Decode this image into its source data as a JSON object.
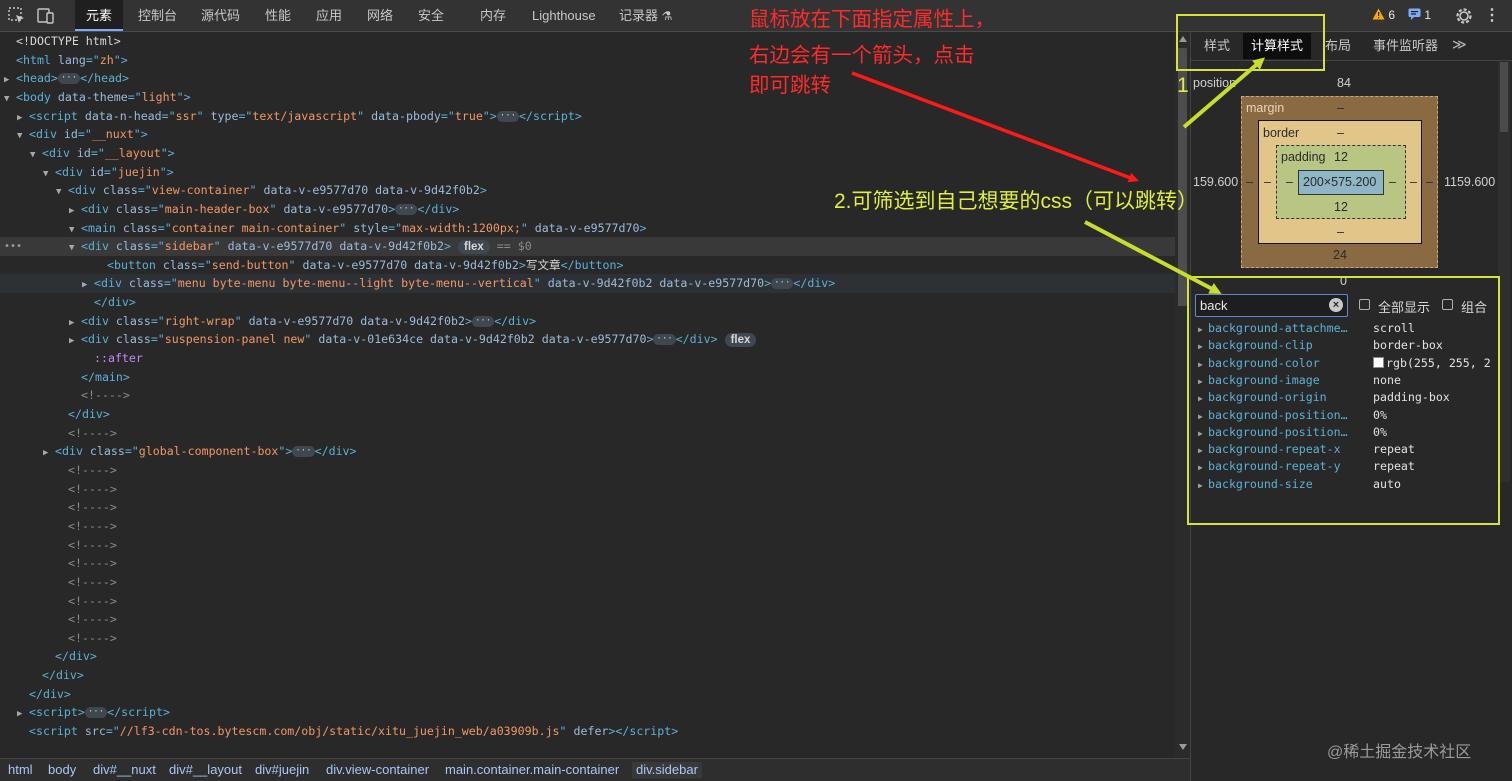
{
  "toolbar": {
    "tabs": [
      "元素",
      "控制台",
      "源代码",
      "性能",
      "应用",
      "网络",
      "安全",
      "内存",
      "Lighthouse",
      "记录器"
    ],
    "warnings_count": "6",
    "messages_count": "1"
  },
  "tree_lines": [
    {
      "text": "<!DOCTYPE html>"
    },
    {
      "tw": "",
      "tag": "html",
      "attrs": [
        [
          "lang",
          "zh"
        ]
      ]
    },
    {
      "tw": "▶",
      "tag": "head",
      "ell": true,
      "close": "head"
    },
    {
      "tw": "▼",
      "tag": "body",
      "attrs": [
        [
          "data-theme",
          "light"
        ]
      ]
    },
    {
      "tw": "▶",
      "tag": "script",
      "attrs": [
        [
          "data-n-head",
          "ssr"
        ],
        [
          "type",
          "text/javascript"
        ],
        [
          "data-pbody",
          "true"
        ]
      ],
      "ell": true,
      "close": "script"
    },
    {
      "tw": "▼",
      "tag": "div",
      "attrs": [
        [
          "id",
          "__nuxt"
        ]
      ]
    },
    {
      "tw": "▼",
      "tag": "div",
      "attrs": [
        [
          "id",
          "__layout"
        ]
      ]
    },
    {
      "tw": "▼",
      "tag": "div",
      "attrs": [
        [
          "id",
          "juejin"
        ]
      ]
    },
    {
      "tw": "▼",
      "tag": "div",
      "attrs": [
        [
          "class",
          "view-container"
        ],
        [
          "data-v-e9577d70",
          null
        ],
        [
          "data-v-9d42f0b2",
          null
        ]
      ]
    },
    {
      "tw": "▶",
      "tag": "div",
      "attrs": [
        [
          "class",
          "main-header-box"
        ],
        [
          "data-v-e9577d70",
          null
        ]
      ],
      "ell": true,
      "close": "div"
    },
    {
      "tw": "▼",
      "tag": "main",
      "attrs": [
        [
          "class",
          "container main-container"
        ],
        [
          "style",
          "max-width:1200px;"
        ],
        [
          "data-v-e9577d70",
          null
        ]
      ]
    },
    {
      "tw": "▼",
      "tag": "div",
      "attrs": [
        [
          "class",
          "sidebar"
        ],
        [
          "data-v-e9577d70",
          null
        ],
        [
          "data-v-9d42f0b2",
          null
        ]
      ],
      "pill": "flex",
      "suffix": "== $0"
    },
    {
      "tw": "",
      "tag": "button",
      "attrs": [
        [
          "class",
          "send-button"
        ],
        [
          "data-v-e9577d70",
          null
        ],
        [
          "data-v-9d42f0b2",
          null
        ]
      ],
      "inner": "写文章",
      "close": "button"
    },
    {
      "tw": "▶",
      "tag": "div",
      "attrs": [
        [
          "class",
          "menu byte-menu byte-menu--light byte-menu--vertical"
        ],
        [
          "data-v-9d42f0b2",
          null
        ],
        [
          "data-v-e9577d70",
          null
        ]
      ],
      "ell": true,
      "close": "div"
    },
    {
      "endtag": "div"
    },
    {
      "tw": "▶",
      "tag": "div",
      "attrs": [
        [
          "class",
          "right-wrap"
        ],
        [
          "data-v-e9577d70",
          null
        ],
        [
          "data-v-9d42f0b2",
          null
        ]
      ],
      "ell": true,
      "close": "div"
    },
    {
      "tw": "▶",
      "tag": "div",
      "attrs": [
        [
          "class",
          "suspension-panel new"
        ],
        [
          "data-v-01e634ce",
          null
        ],
        [
          "data-v-9d42f0b2",
          null
        ],
        [
          "data-v-e9577d70",
          null
        ]
      ],
      "ell": true,
      "close": "div",
      "pill": "flex"
    },
    {
      "pseudo": "::after"
    },
    {
      "endtag": "main"
    },
    {
      "comment": "<!---->"
    },
    {
      "endtag": "div"
    },
    {
      "comment": "<!---->"
    },
    {
      "tw": "▶",
      "tag": "div",
      "attrs": [
        [
          "class",
          "global-component-box"
        ]
      ],
      "ell": true,
      "close": "div"
    },
    {
      "comment": "<!---->"
    },
    {
      "comment": "<!---->"
    },
    {
      "comment": "<!---->"
    },
    {
      "comment": "<!---->"
    },
    {
      "comment": "<!---->"
    },
    {
      "comment": "<!---->"
    },
    {
      "comment": "<!---->"
    },
    {
      "comment": "<!---->"
    },
    {
      "comment": "<!---->"
    },
    {
      "comment": "<!---->"
    },
    {
      "endtag": "div"
    },
    {
      "endtag": "div"
    },
    {
      "endtag": "div"
    },
    {
      "tw": "▶",
      "tag": "script",
      "ell": true,
      "close": "script"
    },
    {
      "tw": "",
      "tag": "script",
      "attrs": [
        [
          "src",
          "//lf3-cdn-tos.bytescm.com/obj/static/xitu_juejin_web/a03909b.js"
        ],
        [
          "defer",
          null
        ]
      ],
      "close": "script"
    }
  ],
  "breadcrumb": [
    "html",
    "body",
    "div#__nuxt",
    "div#__layout",
    "div#juejin",
    "div.view-container",
    "main.container.main-container",
    "div.sidebar"
  ],
  "side_tabs": [
    "样式",
    "计算样式",
    "布局",
    "事件监听器"
  ],
  "box_model": {
    "position_label": "position",
    "position_top": "84",
    "position_bottom": "0",
    "position_left": "159.600",
    "position_right": "1159.600",
    "margin_label": "margin",
    "margin_top": "–",
    "margin_bottom": "24",
    "margin_left": "–",
    "margin_right": "–",
    "border_label": "border",
    "border_top": "–",
    "border_bottom": "–",
    "border_left": "–",
    "border_right": "–",
    "padding_label": "padding",
    "padding_top": "12",
    "padding_bottom": "12",
    "padding_left": "–",
    "padding_right": "–",
    "content": "200×575.200"
  },
  "filter": {
    "value": "back",
    "show_all_label": "全部显示",
    "group_label": "组合"
  },
  "computed": [
    {
      "name": "background-attachme…",
      "value": "scroll"
    },
    {
      "name": "background-clip",
      "value": "border-box"
    },
    {
      "name": "background-color",
      "value": "rgb(255, 255, 2",
      "swatch": "#ffffff"
    },
    {
      "name": "background-image",
      "value": "none"
    },
    {
      "name": "background-origin",
      "value": "padding-box"
    },
    {
      "name": "background-position…",
      "value": "0%"
    },
    {
      "name": "background-position…",
      "value": "0%"
    },
    {
      "name": "background-repeat-x",
      "value": "repeat"
    },
    {
      "name": "background-repeat-y",
      "value": "repeat"
    },
    {
      "name": "background-size",
      "value": "auto"
    }
  ],
  "annotations": {
    "red_line1": "鼠标放在下面指定属性上，",
    "red_line2": "右边会有一个箭头，点击",
    "red_line3": "即可跳转",
    "step1": "1",
    "step2": "2.可筛选到自己想要的css（可以跳转）"
  },
  "watermark": "@稀土掘金技术社区",
  "colors": {
    "accent": "#7cacf8",
    "annotation_red": "#ff2a2a",
    "annotation_yellow": "#d6e338"
  }
}
